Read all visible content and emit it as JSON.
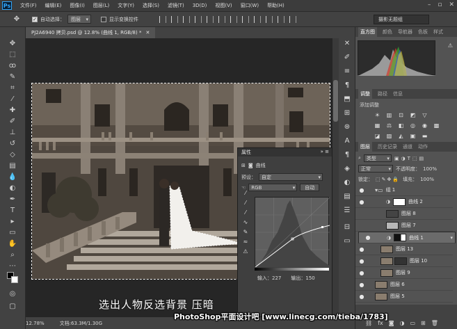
{
  "menubar": {
    "logo": "Ps",
    "items": [
      "文件(F)",
      "编辑(E)",
      "图像(I)",
      "图层(L)",
      "文字(Y)",
      "选择(S)",
      "滤镜(T)",
      "3D(D)",
      "视图(V)",
      "窗口(W)",
      "帮助(H)"
    ],
    "window_controls": [
      "–",
      "▫",
      "✕"
    ]
  },
  "options": {
    "auto_select_label": "自动选择：",
    "auto_select_value": "图层",
    "show_transform_label": "显示变换控件",
    "workspace": "摄影无题组"
  },
  "document": {
    "tab_title": "PJ2A6940 拷贝.psd @ 12.8% (曲线 1, RGB/8) *",
    "tab_close": "✕",
    "caption": "选出人物反选背景 压暗",
    "watermark": "PhotoShop平面设计吧 [www.linecg.com/tieba/1783]"
  },
  "status": {
    "zoom": "12.78%",
    "doc_info": "文档:63.3M/1.30G"
  },
  "properties": {
    "title": "属性",
    "type_label": "曲线",
    "preset_label": "预设：",
    "preset_value": "自定",
    "channel_value": "RGB",
    "auto_button": "自动",
    "input_label": "输入：227",
    "output_label": "输出：150"
  },
  "panel_tabs": {
    "top": [
      "直方图",
      "颜色",
      "导航器",
      "色板",
      "样式"
    ],
    "mid": [
      "调整",
      "路径",
      "信息"
    ],
    "layers": [
      "图层",
      "历史记录",
      "通道",
      "动作"
    ]
  },
  "adjustments": {
    "title": "添加调整"
  },
  "layers_panel": {
    "filter_kind": "类型",
    "blend_mode": "正常",
    "opacity_label": "不透明度：",
    "opacity_value": "100%",
    "lock_label": "锁定：",
    "fill_label": "填充：",
    "fill_value": "100%",
    "layers": [
      {
        "name": "组 1",
        "kind": "group"
      },
      {
        "name": "曲线 2",
        "kind": "adjust"
      },
      {
        "name": "图层 8",
        "kind": "pixel"
      },
      {
        "name": "图层 7",
        "kind": "pixel"
      },
      {
        "name": "曲线 1",
        "kind": "adjust",
        "selected": true
      },
      {
        "name": "图层 13",
        "kind": "pixel"
      },
      {
        "name": "图层 10",
        "kind": "pixel"
      },
      {
        "name": "图层 9",
        "kind": "pixel"
      },
      {
        "name": "图层 6",
        "kind": "pixel"
      },
      {
        "name": "图层 5",
        "kind": "pixel"
      }
    ]
  },
  "colors": {
    "accent": "#31a8ff",
    "bg_dark": "#262626",
    "panel": "#535353"
  }
}
